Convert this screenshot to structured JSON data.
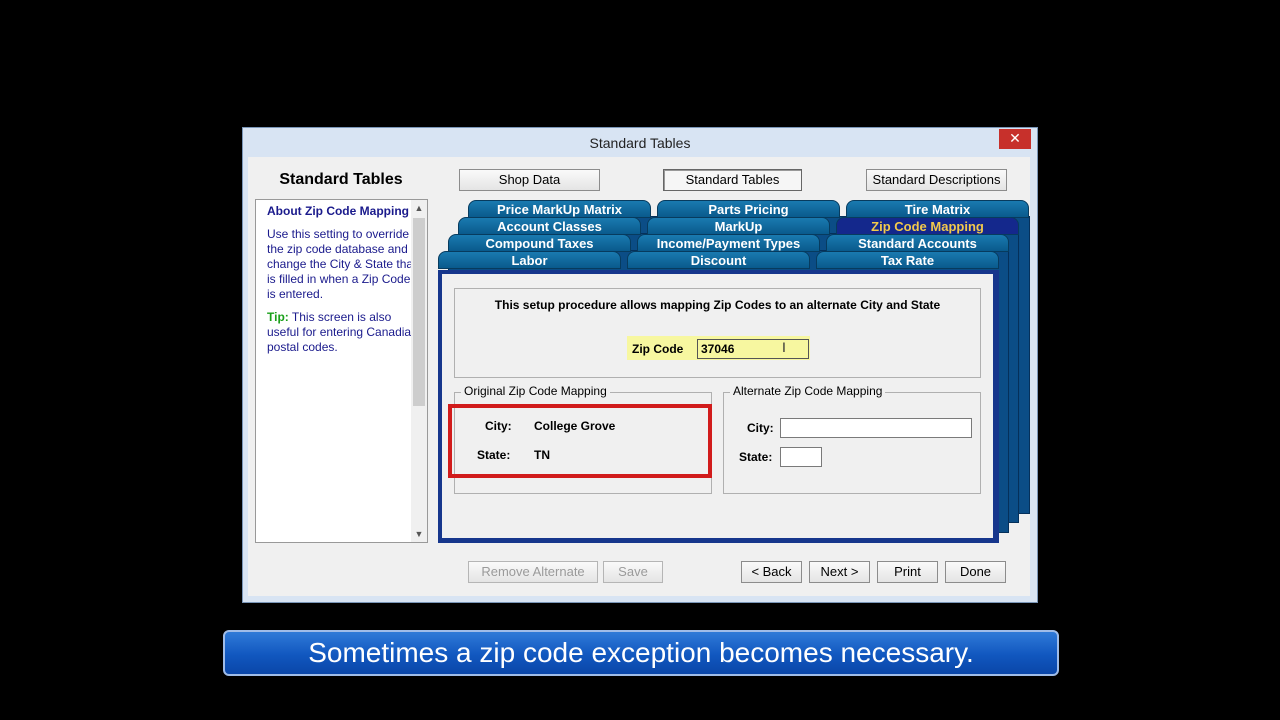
{
  "window": {
    "title": "Standard Tables",
    "close_glyph": "✕"
  },
  "left": {
    "title": "Standard Tables",
    "help": {
      "heading": "About Zip Code Mapping",
      "line1": "Use this setting to override",
      "line2": "the zip code database and",
      "line3": "change the City & State that",
      "line4": "is filled in when a Zip Code",
      "line5": "is entered.",
      "tip_label": "Tip:",
      "tip1": " This screen is also",
      "tip2": "useful for entering Canadian",
      "tip3": "postal codes."
    }
  },
  "top_buttons": {
    "shop_data": "Shop Data",
    "standard_tables": "Standard Tables",
    "standard_descriptions": "Standard Descriptions"
  },
  "tabs": {
    "price_markup_matrix": "Price MarkUp Matrix",
    "parts_pricing": "Parts Pricing",
    "tire_matrix": "Tire Matrix",
    "account_classes": "Account Classes",
    "markup": "MarkUp",
    "zip_code_mapping": "Zip Code Mapping",
    "compound_taxes": "Compound Taxes",
    "income_payment_types": "Income/Payment Types",
    "standard_accounts": "Standard Accounts",
    "labor": "Labor",
    "discount": "Discount",
    "tax_rate": "Tax Rate"
  },
  "panel": {
    "description": "This setup procedure allows mapping Zip Codes to an alternate City and State",
    "zip_label": "Zip Code",
    "zip_value": "37046",
    "original": {
      "title": "Original Zip Code Mapping",
      "city_label": "City:",
      "city_value": "College Grove",
      "state_label": "State:",
      "state_value": "TN"
    },
    "alternate": {
      "title": "Alternate Zip Code Mapping",
      "city_label": "City:",
      "city_value": "",
      "state_label": "State:",
      "state_value": ""
    }
  },
  "bottom_buttons": {
    "remove_alternate": "Remove Alternate",
    "save": "Save",
    "back": "< Back",
    "next": "Next >",
    "print": "Print",
    "done": "Done"
  },
  "caption": "Sometimes a zip code exception becomes necessary.",
  "colors": {
    "tab": "#0a5a8c",
    "active_tab": "#14288c",
    "active_tab_text": "#f2c94c",
    "highlight": "#d11b1b",
    "banner": "#1157bf"
  }
}
